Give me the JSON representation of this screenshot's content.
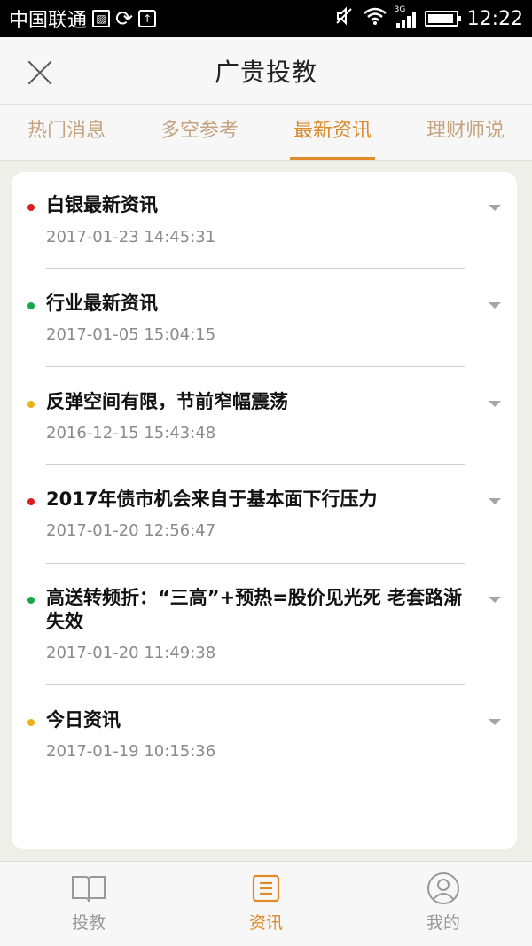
{
  "status_bar": {
    "carrier": "中国联通",
    "network": "3G",
    "time": "12:22",
    "battery_level": 0.95
  },
  "header": {
    "title": "广贵投教",
    "close_icon": "close-icon"
  },
  "tabs": [
    {
      "label": "热门消息",
      "active": false
    },
    {
      "label": "多空参考",
      "active": false
    },
    {
      "label": "最新资讯",
      "active": true
    },
    {
      "label": "理财师说",
      "active": false
    }
  ],
  "news": [
    {
      "title": "白银最新资讯",
      "date": "2017-01-23 14:45:31",
      "dot_color": "#d81f1f"
    },
    {
      "title": "行业最新资讯",
      "date": "2017-01-05 15:04:15",
      "dot_color": "#18a84a"
    },
    {
      "title": "反弹空间有限，节前窄幅震荡",
      "date": "2016-12-15 15:43:48",
      "dot_color": "#e8b21a"
    },
    {
      "title": "2017年债市机会来自于基本面下行压力",
      "date": "2017-01-20 12:56:47",
      "dot_color": "#d81f1f"
    },
    {
      "title": "高送转频折：“三高”+预热=股价见光死 老套路渐失效",
      "date": "2017-01-20 11:49:38",
      "dot_color": "#18a84a"
    },
    {
      "title": "今日资讯",
      "date": "2017-01-19 10:15:36",
      "dot_color": "#e8b21a"
    }
  ],
  "bottom_nav": [
    {
      "label": "投教",
      "icon": "book-icon",
      "active": false
    },
    {
      "label": "资讯",
      "icon": "news-list-icon",
      "active": true
    },
    {
      "label": "我的",
      "icon": "user-icon",
      "active": false
    }
  ]
}
